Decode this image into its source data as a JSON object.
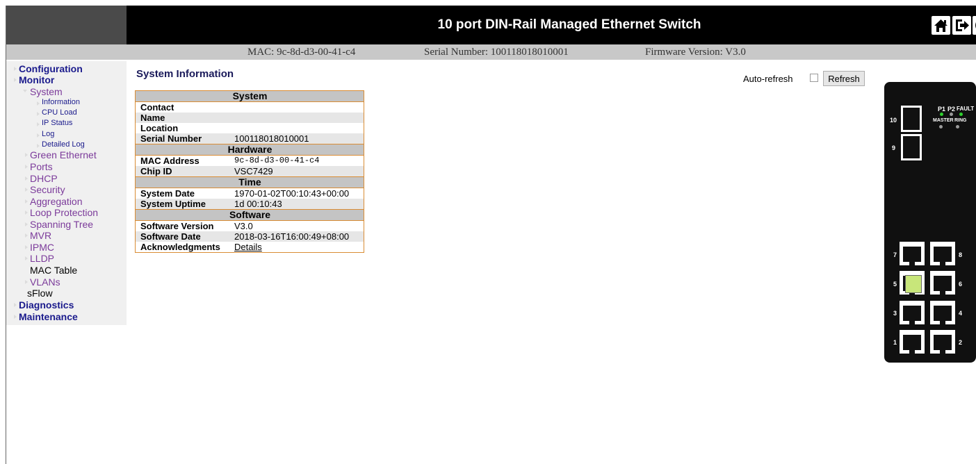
{
  "header": {
    "title": "10 port DIN-Rail Managed Ethernet Switch",
    "icons": [
      "home-icon",
      "logout-icon",
      "help-icon"
    ]
  },
  "infobar": {
    "mac": "MAC: 9c-8d-d3-00-41-c4",
    "serial": "Serial Number: 100118018010001",
    "firmware": "Firmware Version: V3.0"
  },
  "sidebar": {
    "configuration": "Configuration",
    "monitor": "Monitor",
    "system": "System",
    "system_items": [
      "Information",
      "CPU Load",
      "IP Status",
      "Log",
      "Detailed Log"
    ],
    "monitor_items": [
      "Green Ethernet",
      "Ports",
      "DHCP",
      "Security",
      "Aggregation",
      "Loop Protection",
      "Spanning Tree",
      "MVR",
      "IPMC",
      "LLDP",
      "MAC Table",
      "VLANs",
      "sFlow"
    ],
    "diagnostics": "Diagnostics",
    "maintenance": "Maintenance"
  },
  "page": {
    "title": "System Information",
    "auto_refresh_label": "Auto-refresh",
    "refresh_button": "Refresh"
  },
  "system_table": {
    "sections": {
      "system": "System",
      "hardware": "Hardware",
      "time": "Time",
      "software": "Software"
    },
    "rows": {
      "contact": {
        "label": "Contact",
        "value": ""
      },
      "name": {
        "label": "Name",
        "value": ""
      },
      "location": {
        "label": "Location",
        "value": ""
      },
      "serial": {
        "label": "Serial Number",
        "value": "100118018010001"
      },
      "mac": {
        "label": "MAC Address",
        "value": "9c-8d-d3-00-41-c4"
      },
      "chip": {
        "label": "Chip ID",
        "value": "VSC7429"
      },
      "date": {
        "label": "System Date",
        "value": "1970-01-02T00:10:43+00:00"
      },
      "uptime": {
        "label": "System Uptime",
        "value": "1d 00:10:43"
      },
      "sw_version": {
        "label": "Software Version",
        "value": "V3.0"
      },
      "sw_date": {
        "label": "Software Date",
        "value": "2018-03-16T16:00:49+08:00"
      },
      "ack": {
        "label": "Acknowledgments",
        "value": "Details"
      }
    }
  },
  "device": {
    "led_labels": {
      "p1": "P1",
      "p2": "P2",
      "fault": "FAULT",
      "master": "MASTER",
      "ring": "RING"
    },
    "port_labels": {
      "p10": "10",
      "p9": "9",
      "p7": "7",
      "p8": "8",
      "p5": "5",
      "p6": "6",
      "p3": "3",
      "p4": "4",
      "p1": "1",
      "p2": "2"
    },
    "colors": {
      "led_on": "#2fd02f",
      "led_off": "#9a9a9a",
      "port_active": "#c8e67a"
    }
  }
}
